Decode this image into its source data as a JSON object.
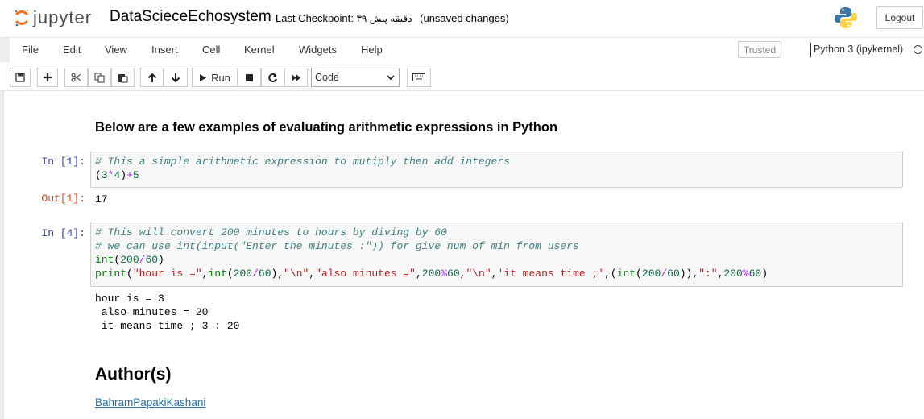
{
  "header": {
    "logo_text": "jupyter",
    "notebook_name": "DataScieceEchosystem",
    "checkpoint_label": "Last Checkpoint:",
    "checkpoint_time": "۳۹ دقیقه پیش",
    "save_status": "(unsaved changes)",
    "logout_label": "Logout"
  },
  "menu": {
    "items": [
      "File",
      "Edit",
      "View",
      "Insert",
      "Cell",
      "Kernel",
      "Widgets",
      "Help"
    ],
    "trusted_label": "Trusted",
    "kernel_name": "Python 3 (ipykernel)"
  },
  "toolbar": {
    "run_label": "Run",
    "cell_type": "Code"
  },
  "cells": {
    "md_heading": "Below are a few examples of evaluating arithmetic expressions in Python",
    "cell1": {
      "prompt_in": "In [1]:",
      "line1": "# This a simple arithmetic expression to mutiply then add integers",
      "line2_a": "(",
      "line2_b": "3",
      "line2_c": "*",
      "line2_d": "4",
      "line2_e": ")",
      "line2_f": "+",
      "line2_g": "5",
      "prompt_out": "Out[1]:",
      "output": "17"
    },
    "cell2": {
      "prompt_in": "In [4]:",
      "line1": "# This will convert 200 minutes to hours by diving by 60",
      "line2": "# we can use int(input(\"Enter the minutes :\")) for give num of min from users",
      "line3_fn": "int",
      "line3_a": "(",
      "line3_n1": "200",
      "line3_op": "/",
      "line3_n2": "60",
      "line3_b": ")",
      "line4_fn": "print",
      "line4_s1": "\"hour is =\"",
      "line4_int": "int",
      "line4_n1": "200",
      "line4_n2": "60",
      "line4_s2": "\"\\n\"",
      "line4_s3": "\"also minutes =\"",
      "line4_n3": "200",
      "line4_mod": "%",
      "line4_n4": "60",
      "line4_s4": "\"\\n\"",
      "line4_s5": "'it means time ;'",
      "line4_int2": "int",
      "line4_n5": "200",
      "line4_n6": "60",
      "line4_s6": "\":\"",
      "line4_n7": "200",
      "line4_n8": "60",
      "output": "hour is = 3\n also minutes = 20\n it means time ; 3 : 20"
    },
    "author_heading": "Author(s)",
    "author_link": "BahramPapakiKashani"
  }
}
